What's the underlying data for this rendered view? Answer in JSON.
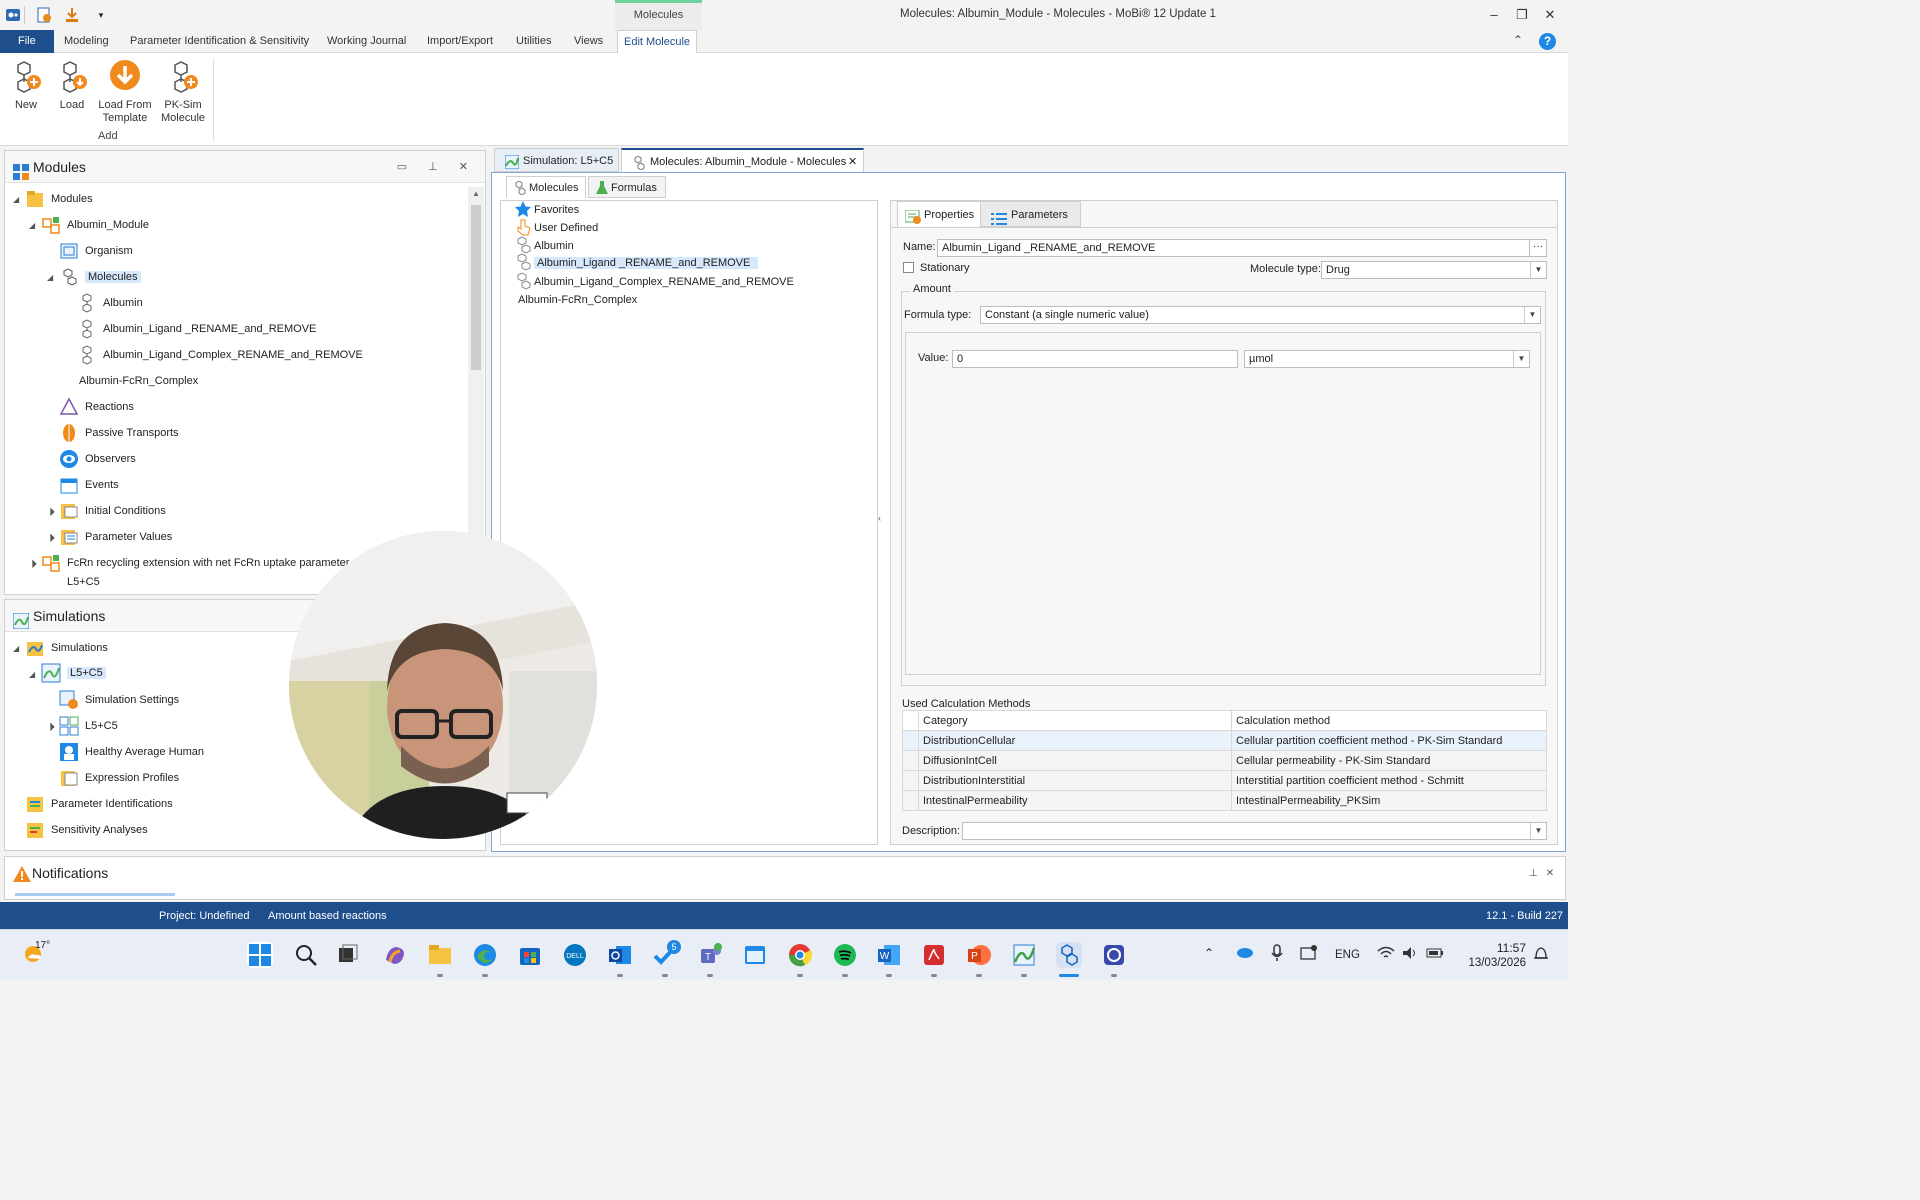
{
  "window": {
    "title": "Molecules: Albumin_Module - Molecules - MoBi® 12 Update 1",
    "context_tab": "Molecules",
    "minimize": "–",
    "restore": "❐",
    "close": "✕"
  },
  "ribbon_tabs": [
    "File",
    "Modeling",
    "Parameter Identification & Sensitivity",
    "Working Journal",
    "Import/Export",
    "Utilities",
    "Views",
    "Edit Molecule"
  ],
  "ribbon": {
    "buttons": [
      {
        "line1": "New",
        "line2": ""
      },
      {
        "line1": "Load",
        "line2": ""
      },
      {
        "line1": "Load From",
        "line2": "Template"
      },
      {
        "line1": "PK-Sim",
        "line2": "Molecule"
      }
    ],
    "group": "Add",
    "collapse": "⌃",
    "help": "?"
  },
  "modules_panel": {
    "title": "Modules",
    "items": [
      "Modules",
      "Albumin_Module",
      "Organism",
      "Molecules",
      "Albumin",
      "Albumin_Ligand _RENAME_and_REMOVE",
      "Albumin_Ligand_Complex_RENAME_and_REMOVE",
      "Albumin-FcRn_Complex",
      "Reactions",
      "Passive Transports",
      "Observers",
      "Events",
      "Initial Conditions",
      "Parameter Values",
      "FcRn recycling extension with net FcRn uptake parameter mi",
      "L5+C5"
    ]
  },
  "simulations_panel": {
    "title": "Simulations",
    "items": [
      "Simulations",
      "L5+C5",
      "Simulation Settings",
      "L5+C5",
      "Healthy Average Human",
      "Expression Profiles",
      "Parameter Identifications",
      "Sensitivity Analyses"
    ]
  },
  "doc_tabs": [
    "Simulation: L5+C5",
    "Molecules: Albumin_Module - Molecules"
  ],
  "sub_tabs": [
    "Molecules",
    "Formulas"
  ],
  "molecule_list": [
    "Favorites",
    "User Defined",
    "Albumin",
    "Albumin_Ligand _RENAME_and_REMOVE",
    "Albumin_Ligand_Complex_RENAME_and_REMOVE",
    "Albumin-FcRn_Complex"
  ],
  "props": {
    "tabs": [
      "Properties",
      "Parameters"
    ],
    "name_label": "Name:",
    "name_value": "Albumin_Ligand _RENAME_and_REMOVE",
    "stationary_label": "Stationary",
    "molecule_type_label": "Molecule type:",
    "molecule_type_value": "Drug",
    "amount_group": "Amount",
    "formula_type_label": "Formula type:",
    "formula_type_value": "Constant (a single numeric value)",
    "value_label": "Value:",
    "value": "0",
    "unit": "µmol",
    "calc_methods_label": "Used Calculation Methods",
    "calc_headers": [
      "Category",
      "Calculation method"
    ],
    "calc_rows": [
      [
        "DistributionCellular",
        "Cellular partition coefficient method - PK-Sim Standard"
      ],
      [
        "DiffusionIntCell",
        "Cellular permeability - PK-Sim Standard"
      ],
      [
        "DistributionInterstitial",
        "Interstitial partition coefficient method - Schmitt"
      ],
      [
        "IntestinalPermeability",
        "IntestinalPermeability_PKSim"
      ]
    ],
    "description_label": "Description:"
  },
  "notifications": {
    "title": "Notifications"
  },
  "status": {
    "project": "Project: Undefined",
    "mode": "Amount based reactions",
    "build": "12.1 - Build 227"
  },
  "taskbar": {
    "weather": "17°",
    "lang": "ENG",
    "time": "11:57",
    "date": "13/03/2026",
    "badge": "5"
  }
}
